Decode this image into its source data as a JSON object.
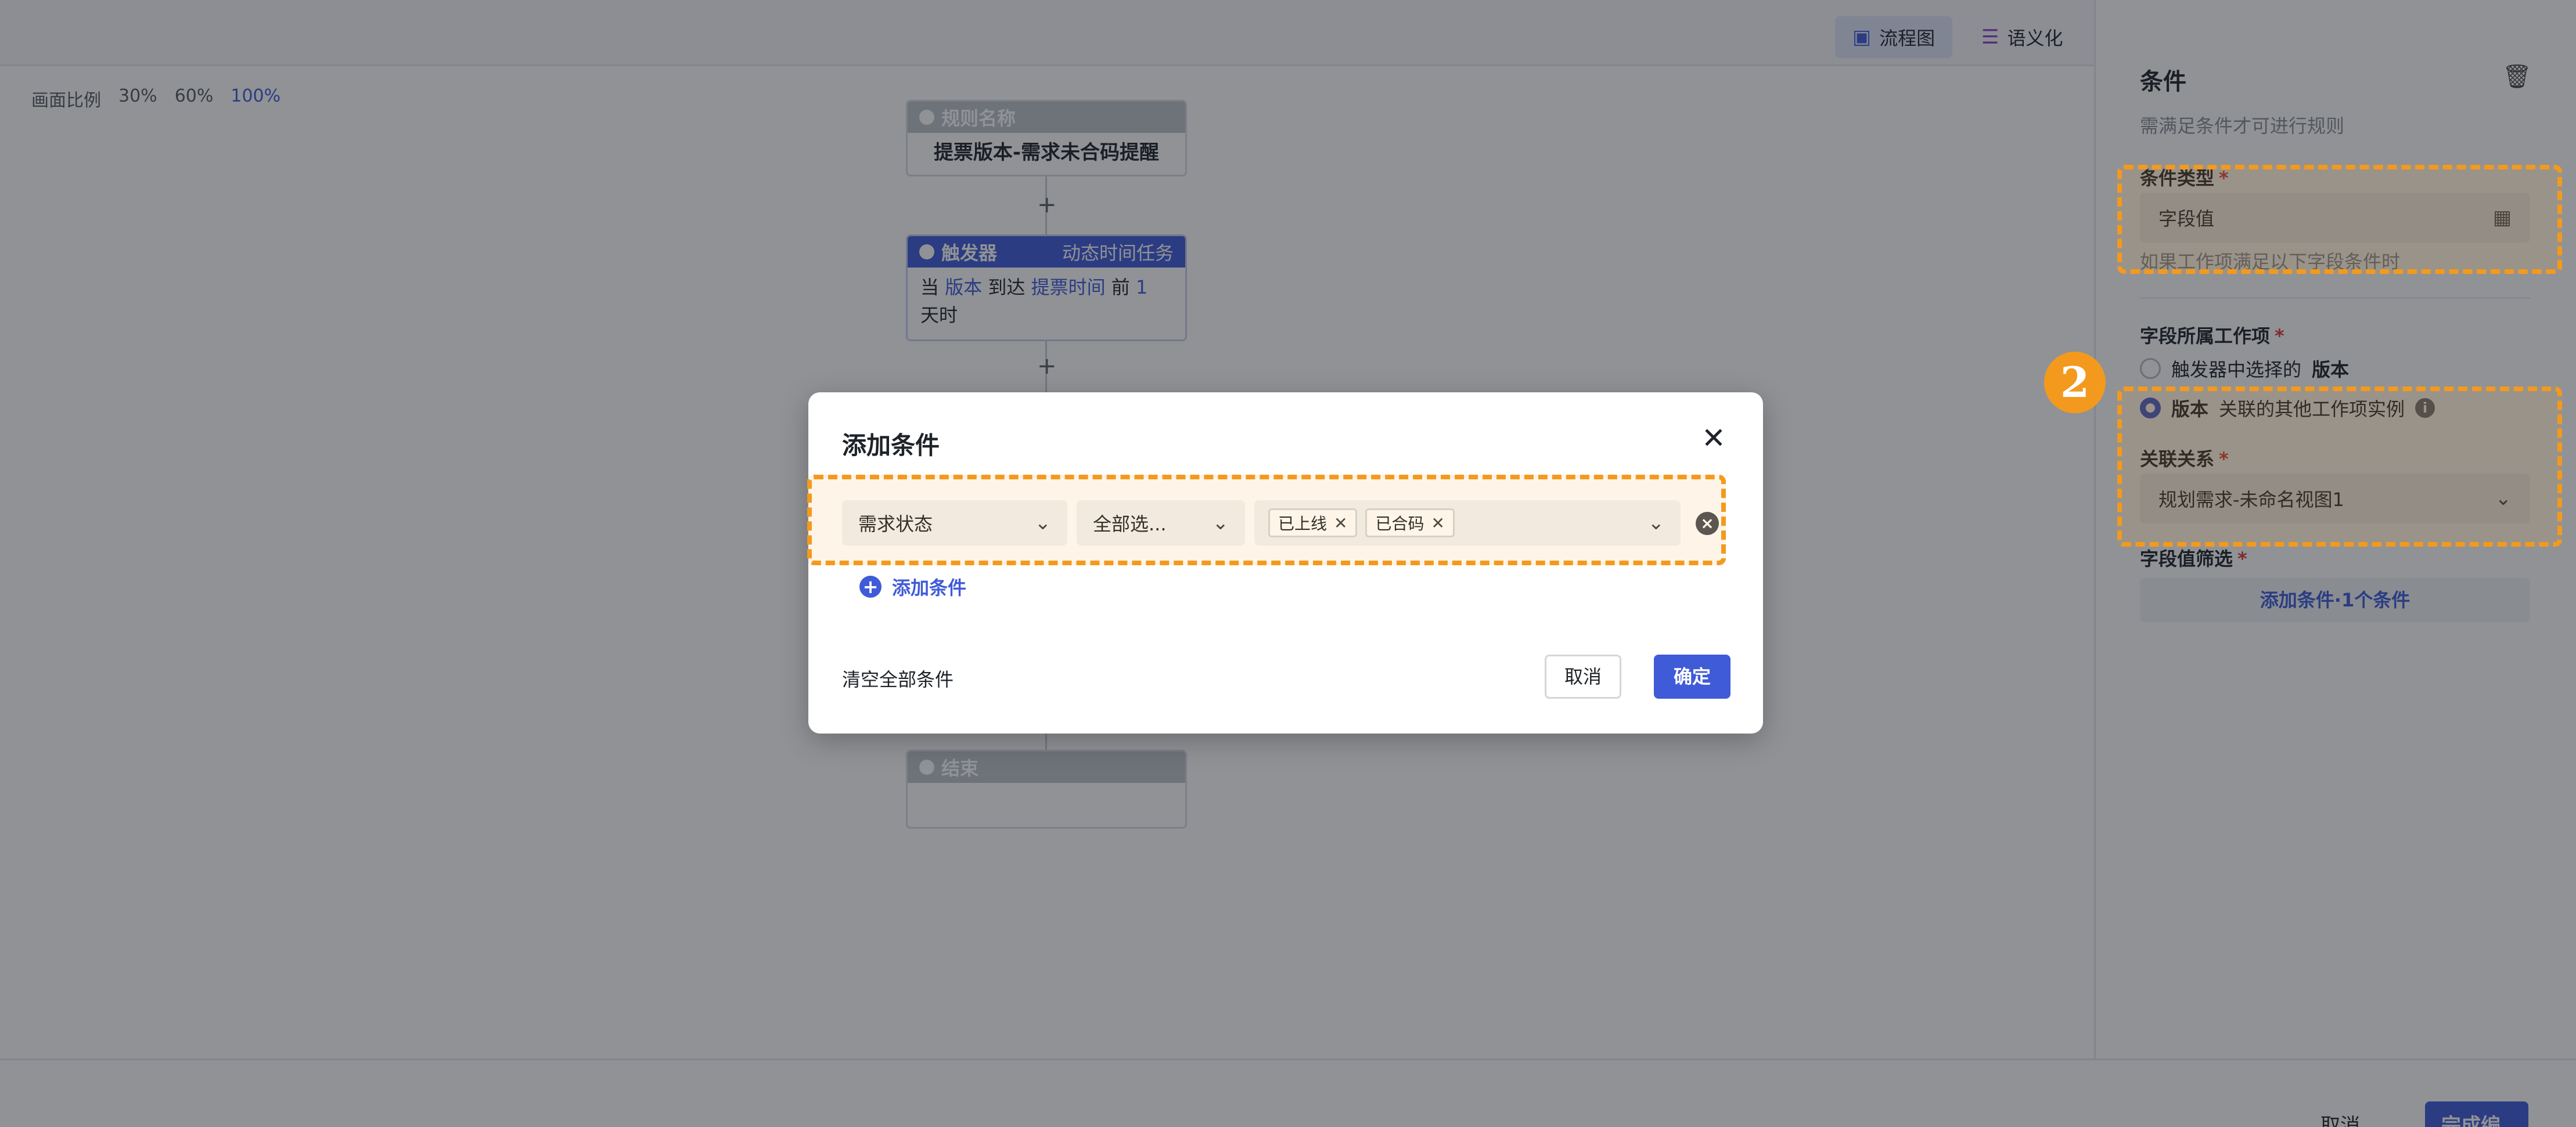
{
  "topbar": {
    "views": [
      {
        "label": "流程图",
        "icon": "flowchart-icon",
        "active": true
      },
      {
        "label": "语义化",
        "icon": "list-icon",
        "active": false
      }
    ]
  },
  "canvas": {
    "ratio": {
      "label": "画面比例",
      "options": [
        "30%",
        "60%",
        "100%"
      ],
      "active": "100%"
    },
    "rule_node": {
      "header": "规则名称",
      "name": "提票版本-需求未合码提醒"
    },
    "trigger_node": {
      "header": "触发器",
      "type": "动态时间任务",
      "text": {
        "w1": "当",
        "entity": "版本",
        "w2": "到达",
        "field": "提票时间",
        "w3": "前",
        "num": "1",
        "w4": "天时"
      }
    },
    "end_node": {
      "header": "结束"
    },
    "plus": "+"
  },
  "panel": {
    "title": "条件",
    "description": "需满足条件才可进行规则",
    "condition_type": {
      "label": "条件类型",
      "value": "字段值",
      "hint": "如果工作项满足以下字段条件时"
    },
    "field_owner": {
      "label": "字段所属工作项",
      "options": [
        {
          "prefix": "触发器中选择的",
          "entity": "版本",
          "checked": false
        },
        {
          "prefix": "版本",
          "entity": "关联的其他工作项实例",
          "checked": true
        }
      ]
    },
    "relation": {
      "label": "关联关系",
      "value": "规划需求-未命名视图1"
    },
    "field_filter": {
      "label": "字段值筛选",
      "button": "添加条件·1个条件"
    },
    "required_mark": "*"
  },
  "step_badge": "2",
  "modal": {
    "title": "添加条件",
    "condition": {
      "field": "需求状态",
      "operator": "全部选...",
      "values": [
        "已上线",
        "已合码"
      ]
    },
    "add_condition": "添加条件",
    "clear_all": "清空全部条件",
    "cancel": "取消",
    "confirm": "确定"
  },
  "bottom": {
    "cancel": "取消",
    "finish": "完成编辑"
  },
  "colors": {
    "accent": "#3f5bd8",
    "highlight": "#f39a1e",
    "overlay": "rgba(24,28,36,0.48)"
  }
}
